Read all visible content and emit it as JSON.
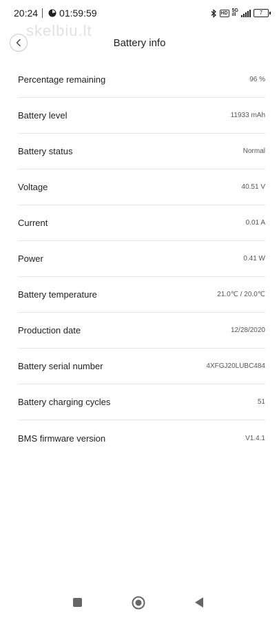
{
  "status_bar": {
    "time": "20:24",
    "timer": "01:59:59",
    "network_top": "5G",
    "network_bottom": "ill",
    "volte_badge": "HD",
    "battery_level": "7"
  },
  "watermark": "skelbiu.lt",
  "header": {
    "title": "Battery info"
  },
  "rows": [
    {
      "label": "Percentage remaining",
      "value": "96 %"
    },
    {
      "label": "Battery level",
      "value": "11933 mAh"
    },
    {
      "label": "Battery status",
      "value": "Normal"
    },
    {
      "label": "Voltage",
      "value": "40.51 V"
    },
    {
      "label": "Current",
      "value": "0.01 A"
    },
    {
      "label": "Power",
      "value": "0.41 W"
    },
    {
      "label": "Battery temperature",
      "value": "21.0℃ / 20.0℃"
    },
    {
      "label": "Production date",
      "value": "12/28/2020"
    },
    {
      "label": "Battery serial number",
      "value": "4XFGJ20LUBC484"
    },
    {
      "label": "Battery charging cycles",
      "value": "51"
    },
    {
      "label": "BMS firmware version",
      "value": "V1.4.1"
    }
  ],
  "icons": {
    "back": "chevron-left-icon",
    "bluetooth": "bluetooth-icon",
    "signal": "signal-icon",
    "battery": "battery-icon",
    "nav_recent": "square-icon",
    "nav_home": "circle-icon",
    "nav_back": "triangle-back-icon"
  }
}
